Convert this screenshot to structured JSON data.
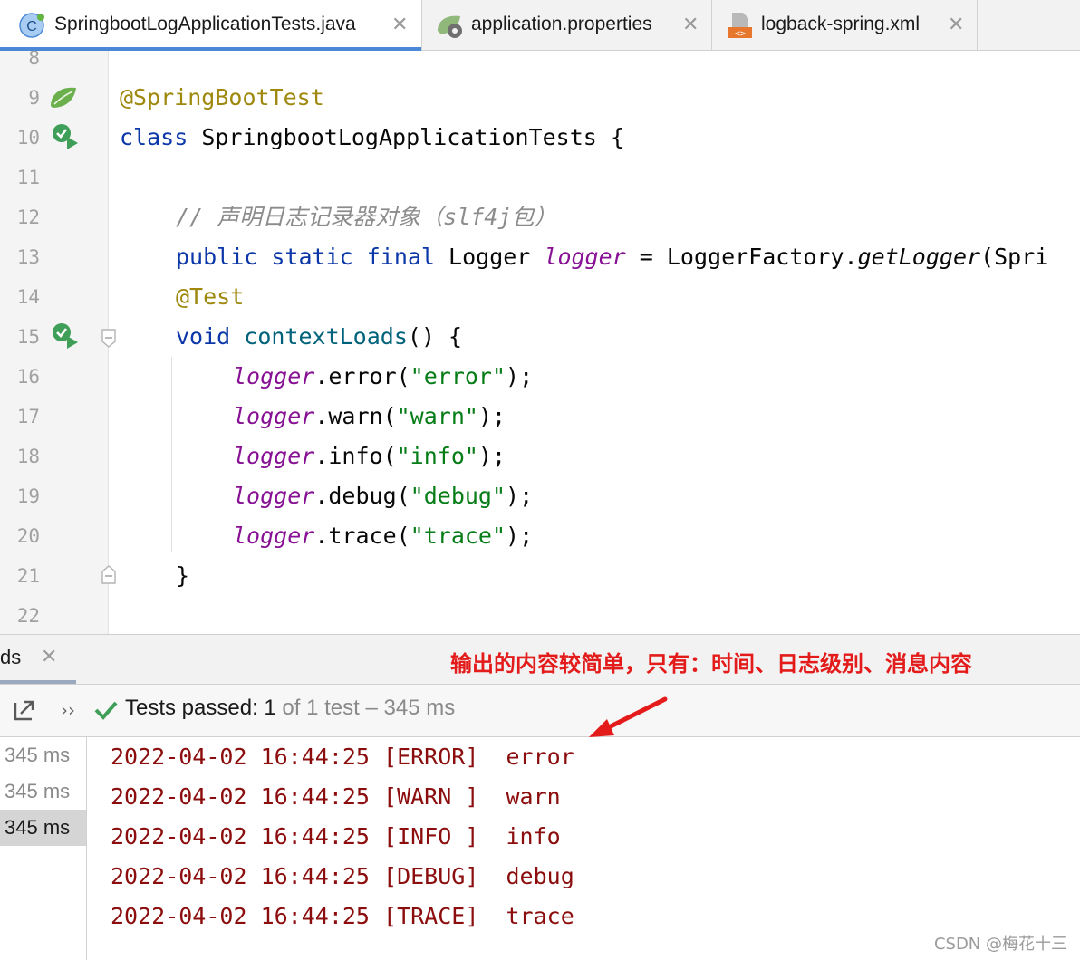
{
  "tabs": [
    {
      "label": "SpringbootLogApplicationTests.java",
      "icon": "java-class-icon",
      "active": true
    },
    {
      "label": "application.properties",
      "icon": "properties-file-icon",
      "active": false
    },
    {
      "label": "logback-spring.xml",
      "icon": "xml-file-icon",
      "active": false
    }
  ],
  "editor": {
    "line_numbers": [
      "8",
      "9",
      "10",
      "11",
      "12",
      "13",
      "14",
      "15",
      "16",
      "17",
      "18",
      "19",
      "20",
      "21",
      "22"
    ],
    "code": {
      "l9_annotation": "@SpringBootTest",
      "l10_kw": "class",
      "l10_rest": " SpringbootLogApplicationTests {",
      "l12_comment": "// 声明日志记录器对象（slf4j包）",
      "l13_kw": "public static final",
      "l13_type": " Logger ",
      "l13_field": "logger",
      "l13_mid": " = LoggerFactory.",
      "l13_method": "getLogger",
      "l13_tail": "(Spri",
      "l14_annotation": "@Test",
      "l15_kw": "void",
      "l15_method": " contextLoads",
      "l15_tail": "() {",
      "field": "logger",
      "l16_call": ".error(",
      "l16_str": "\"error\"",
      "l17_call": ".warn(",
      "l17_str": "\"warn\"",
      "l18_call": ".info(",
      "l18_str": "\"info\"",
      "l19_call": ".debug(",
      "l19_str": "\"debug\"",
      "l20_call": ".trace(",
      "l20_str": "\"trace\"",
      "stmt_end": ");",
      "l21_brace": "}"
    }
  },
  "run_panel": {
    "tab_label": "ds",
    "annotation_note": "输出的内容较简单，只有：时间、日志级别、消息内容",
    "status_passed": "Tests passed: 1",
    "status_rest": " of 1 test – 345 ms",
    "tree_times": [
      "345 ms",
      "345 ms",
      "345 ms"
    ],
    "log_lines": [
      "2022-04-02 16:44:25 [ERROR]  error",
      "2022-04-02 16:44:25 [WARN ]  warn",
      "2022-04-02 16:44:25 [INFO ]  info",
      "2022-04-02 16:44:25 [DEBUG]  debug",
      "2022-04-02 16:44:25 [TRACE]  trace"
    ]
  },
  "watermark": "CSDN @梅花十三",
  "colors": {
    "keyword": "#0b37a8",
    "annotation": "#9e880d",
    "string": "#067d17",
    "field": "#871094",
    "log_text": "#8b0d0d",
    "note_red": "#e31b1b",
    "active_tab_underline": "#4a87d6"
  }
}
